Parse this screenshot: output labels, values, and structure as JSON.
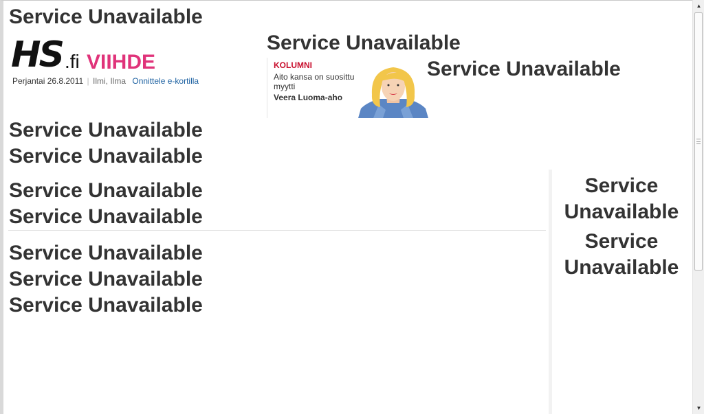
{
  "errors": {
    "top": "Service Unavailable",
    "mid_header": "Service Unavailable",
    "right_header": "Service Unavailable",
    "block1_a": "Service Unavailable",
    "block1_b": "Service Unavailable",
    "block2_a": "Service Unavailable",
    "block2_b": "Service Unavailable",
    "block3_a": "Service Unavailable",
    "block3_b": "Service Unavailable",
    "block3_c": "Service Unavailable",
    "sidebar_a": "Service Unavailable",
    "sidebar_b": "Service Unavailable"
  },
  "header": {
    "logo_hs": "HS",
    "logo_fi": ".fi",
    "logo_section": "VIIHDE",
    "date": "Perjantai 26.8.2011",
    "separator": "|",
    "weather": "Ilmi, Ilma",
    "ecard_link": "Onnittele e-kortilla"
  },
  "column": {
    "kicker": "KOLUMNI",
    "title": "Aito kansa on suosittu myytti",
    "author": "Veera Luoma-aho"
  },
  "colors": {
    "brand_pink": "#e0337a",
    "kicker_red": "#c8102e",
    "link_blue": "#1a5fa0"
  }
}
